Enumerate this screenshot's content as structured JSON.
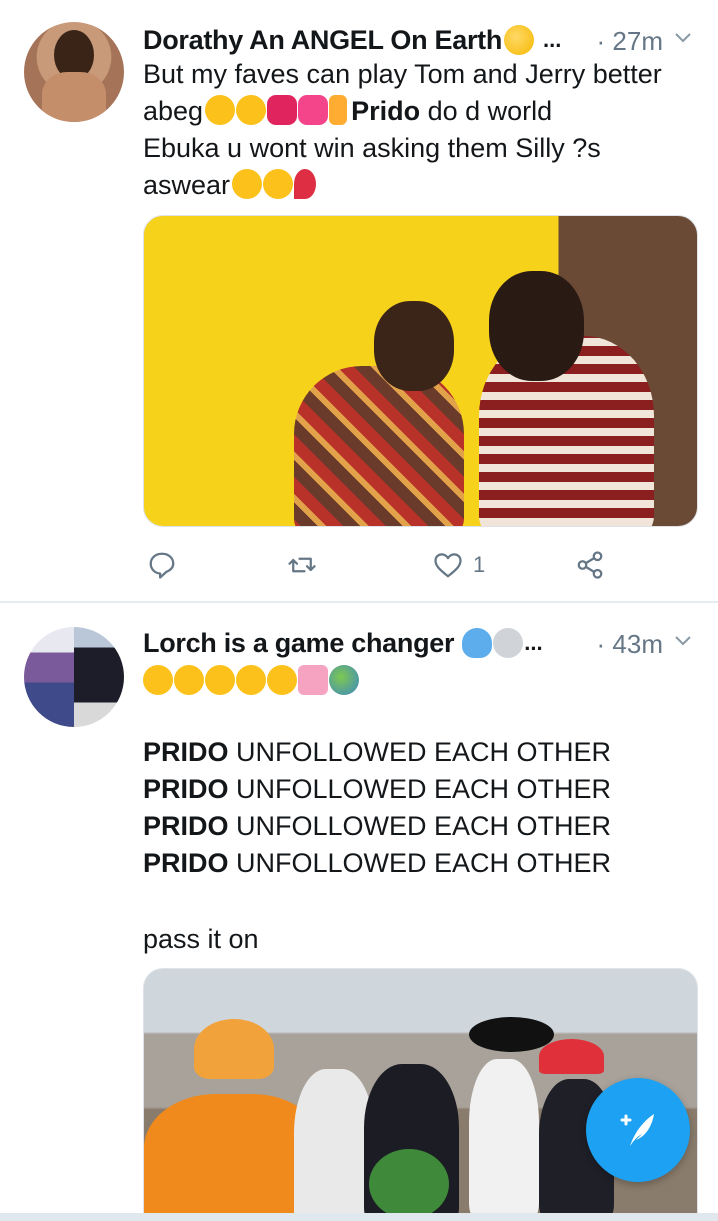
{
  "tweets": [
    {
      "display_name": "Dorathy An ANGEL On Earth",
      "name_emoji": "kissing-face-emoji",
      "name_truncation": "...",
      "time": "· 27m",
      "body_lines": [
        "But my faves can play Tom and Jerry better",
        "abeg",
        "Prido",
        " do d world",
        "Ebuka u wont win asking them Silly ?s",
        "aswear"
      ],
      "media_description_icon": "photo-man-and-woman-yellow-background",
      "actions": {
        "reply_count": "",
        "retweet_count": "",
        "like_count": "1"
      }
    },
    {
      "display_name": "Lorch is a game changer",
      "name_truncation": "...",
      "time": "· 43m",
      "body_bold": "PRIDO",
      "body_rest": " UNFOLLOWED EACH OTHER",
      "repeat_lines": 4,
      "closing_line": "pass it on",
      "media_description_icon": "photo-group-of-people-street"
    }
  ],
  "compose_button_icon": "compose-feather-icon",
  "colors": {
    "accent": "#1da1f2",
    "secondary_text": "#657786",
    "divider": "#e6ecf0"
  }
}
